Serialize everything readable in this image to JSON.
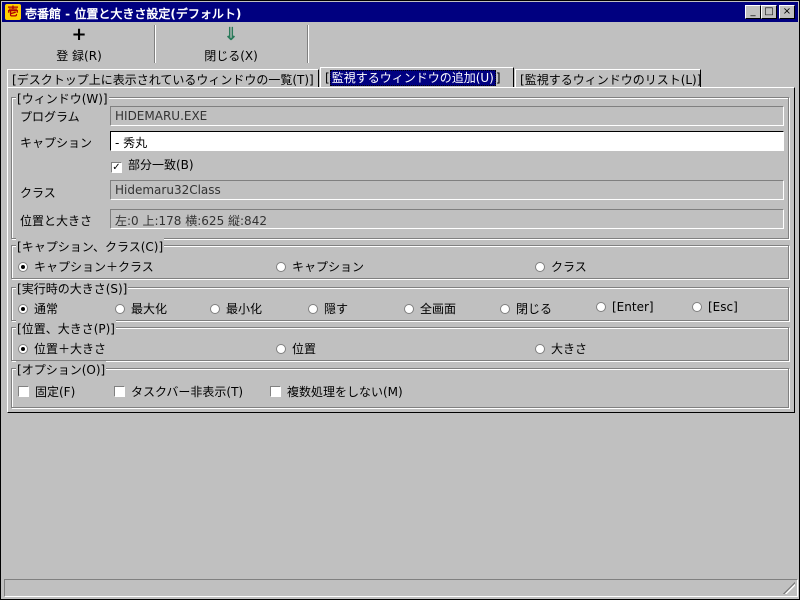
{
  "window": {
    "title": "壱番館 - 位置と大きさ設定(デフォルト)",
    "icon_char": "壱",
    "controls": [
      "_",
      "□",
      "×"
    ]
  },
  "toolbar": [
    {
      "icon": "+",
      "label": "登 録(R)"
    },
    {
      "icon": "⇓",
      "label": "閉じる(X)"
    }
  ],
  "tabs": [
    {
      "label": "デスクトップ上に表示されているウィンドウの一覧(T)",
      "active": false
    },
    {
      "label": "監視するウィンドウの追加(U)",
      "active": true
    },
    {
      "label": "監視するウィンドウのリスト(L)",
      "active": false
    }
  ],
  "window_group": {
    "title": "ウィンドウ(W)",
    "program_label": "プログラム",
    "program_value": "HIDEMARU.EXE",
    "caption_label": "キャプション",
    "caption_value": " - 秀丸",
    "partial_match_label": "部分一致(B)",
    "partial_match_checked": true,
    "class_label": "クラス",
    "class_value": "Hidemaru32Class",
    "pos_label": "位置と大きさ",
    "pos_value": "左:0 上:178 横:625 縦:842"
  },
  "caption_class_group": {
    "title": "キャプション、クラス(C)",
    "options": [
      "キャプション＋クラス",
      "キャプション",
      "クラス"
    ],
    "selected": 0
  },
  "size_group": {
    "title": "実行時の大きさ(S)",
    "options": [
      "通常",
      "最大化",
      "最小化",
      "隠す",
      "全画面",
      "閉じる",
      "[Enter]",
      "[Esc]"
    ],
    "selected": 0
  },
  "position_group": {
    "title": "位置、大きさ(P)",
    "options": [
      "位置＋大きさ",
      "位置",
      "大きさ"
    ],
    "selected": 0
  },
  "options_group": {
    "title": "オプション(O)",
    "items": [
      {
        "label": "固定(F)",
        "checked": false
      },
      {
        "label": "タスクバー非表示(T)",
        "checked": false
      },
      {
        "label": "複数処理をしない(M)",
        "checked": false
      }
    ]
  }
}
